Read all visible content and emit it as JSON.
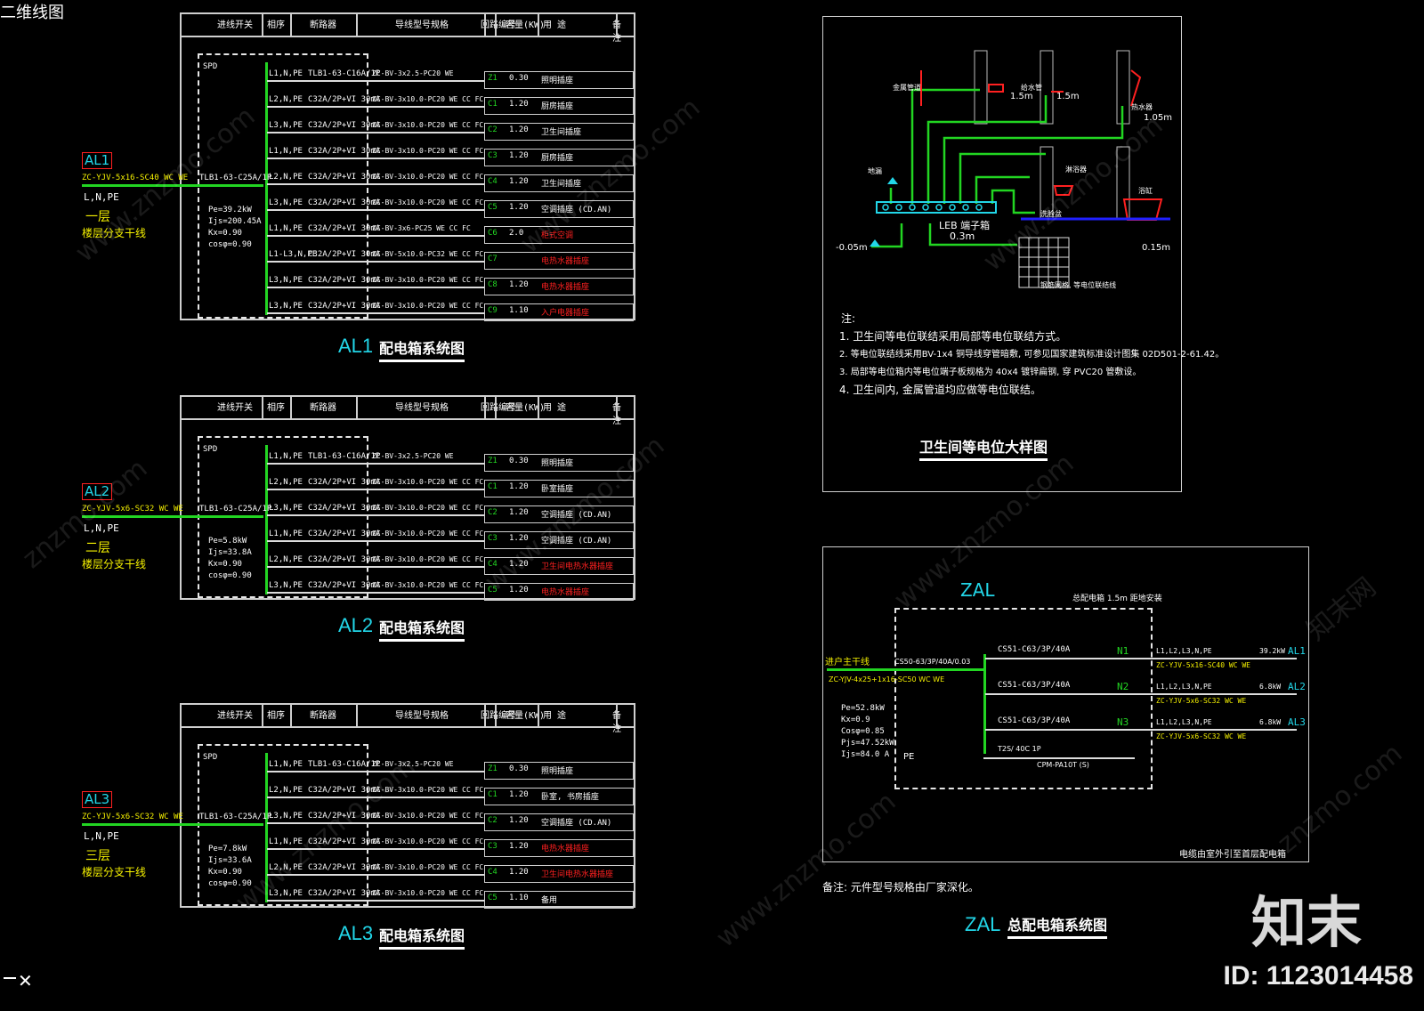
{
  "page_title": "二维线图",
  "panels": [
    {
      "id": "AL1",
      "feeder_cable": "ZC-YJV-5x16-SC40 WC WE",
      "phase": "L,N,PE",
      "floor": "一层",
      "floor_desc": "楼层分支干线",
      "main_breaker": "TLB1-63-C25A/1P",
      "params": [
        "Pe=39.2kW",
        "Ijs=200.45A",
        "Kx=0.90",
        "cosφ=0.90"
      ],
      "spd": "SPD",
      "caption": "AL1",
      "caption_cn": "配电箱系统图",
      "rows": [
        {
          "phase": "L1,N,PE",
          "breaker": "TLB1-63-C16A/1P",
          "cable": "ZC-BV-3x2.5-PC20 WE",
          "num": "Z1",
          "kw": "0.30",
          "desc": "照明插座",
          "red": false
        },
        {
          "phase": "L2,N,PE",
          "breaker": "C32A/2P+VI 30mA",
          "cable": "ZC-BV-3x10.0-PC20 WE CC FC",
          "num": "C1",
          "kw": "1.20",
          "desc": "厨房插座",
          "red": false
        },
        {
          "phase": "L3,N,PE",
          "breaker": "C32A/2P+VI 30mA",
          "cable": "ZC-BV-3x10.0-PC20 WE CC FC",
          "num": "C2",
          "kw": "1.20",
          "desc": "卫生间插座",
          "red": false
        },
        {
          "phase": "L1,N,PE",
          "breaker": "C32A/2P+VI 30mA",
          "cable": "ZC-BV-3x10.0-PC20 WE CC FC",
          "num": "C3",
          "kw": "1.20",
          "desc": "厨房插座",
          "red": false
        },
        {
          "phase": "L2,N,PE",
          "breaker": "C32A/2P+VI 30mA",
          "cable": "ZC-BV-3x10.0-PC20 WE CC FC",
          "num": "C4",
          "kw": "1.20",
          "desc": "卫生间插座",
          "red": false
        },
        {
          "phase": "L3,N,PE",
          "breaker": "C32A/2P+VI 30mA",
          "cable": "ZC-BV-3x10.0-PC20 WE CC FC",
          "num": "C5",
          "kw": "1.20",
          "desc": "空调插座 (CD.AN)",
          "red": false
        },
        {
          "phase": "L1,N,PE",
          "breaker": "C32A/2P+VI 30mA",
          "cable": "ZC-BV-3x6-PC25 WE CC FC",
          "num": "C6",
          "kw": "2.0",
          "desc": "柜式空调",
          "red": true
        },
        {
          "phase": "L1-L3,N,PE",
          "breaker": "C32A/2P+VI 30mA",
          "cable": "ZC-BV-5x10.0-PC32 WE CC FC",
          "num": "C7",
          "kw": "",
          "desc": "电热水器插座",
          "red": true
        },
        {
          "phase": "L3,N,PE",
          "breaker": "C32A/2P+VI 30mA",
          "cable": "ZC-BV-3x10.0-PC20 WE CC FC",
          "num": "C8",
          "kw": "1.20",
          "desc": "电热水器插座",
          "red": true
        },
        {
          "phase": "L3,N,PE",
          "breaker": "C32A/2P+VI 30mA",
          "cable": "ZC-BV-3x10.0-PC20 WE CC FC",
          "num": "C9",
          "kw": "1.10",
          "desc": "入户电器插座",
          "red": true
        }
      ]
    },
    {
      "id": "AL2",
      "feeder_cable": "ZC-YJV-5x6-SC32 WC WE",
      "phase": "L,N,PE",
      "floor": "二层",
      "floor_desc": "楼层分支干线",
      "main_breaker": "TLB1-63-C25A/1P",
      "params": [
        "Pe=5.8kW",
        "Ijs=33.8A",
        "Kx=0.90",
        "cosφ=0.90"
      ],
      "spd": "SPD",
      "caption": "AL2",
      "caption_cn": "配电箱系统图",
      "rows": [
        {
          "phase": "L1,N,PE",
          "breaker": "TLB1-63-C16A/1P",
          "cable": "ZC-BV-3x2.5-PC20 WE",
          "num": "Z1",
          "kw": "0.30",
          "desc": "照明插座",
          "red": false
        },
        {
          "phase": "L2,N,PE",
          "breaker": "C32A/2P+VI 30mA",
          "cable": "ZC-BV-3x10.0-PC20 WE CC FC",
          "num": "C1",
          "kw": "1.20",
          "desc": "卧室插座",
          "red": false
        },
        {
          "phase": "L3,N,PE",
          "breaker": "C32A/2P+VI 30mA",
          "cable": "ZC-BV-3x10.0-PC20 WE CC FC",
          "num": "C2",
          "kw": "1.20",
          "desc": "空调插座 (CD.AN)",
          "red": false
        },
        {
          "phase": "L1,N,PE",
          "breaker": "C32A/2P+VI 30mA",
          "cable": "ZC-BV-3x10.0-PC20 WE CC FC",
          "num": "C3",
          "kw": "1.20",
          "desc": "空调插座 (CD.AN)",
          "red": false
        },
        {
          "phase": "L2,N,PE",
          "breaker": "C32A/2P+VI 30mA",
          "cable": "ZC-BV-3x10.0-PC20 WE CC FC",
          "num": "C4",
          "kw": "1.20",
          "desc": "卫生间电热水器插座",
          "red": true
        },
        {
          "phase": "L3,N,PE",
          "breaker": "C32A/2P+VI 30mA",
          "cable": "ZC-BV-3x10.0-PC20 WE CC FC",
          "num": "C5",
          "kw": "1.20",
          "desc": "电热水器插座",
          "red": true
        }
      ]
    },
    {
      "id": "AL3",
      "feeder_cable": "ZC-YJV-5x6-SC32 WC WE",
      "phase": "L,N,PE",
      "floor": "三层",
      "floor_desc": "楼层分支干线",
      "main_breaker": "TLB1-63-C25A/1P",
      "params": [
        "Pe=7.8kW",
        "Ijs=33.6A",
        "Kx=0.90",
        "cosφ=0.90"
      ],
      "spd": "SPD",
      "caption": "AL3",
      "caption_cn": "配电箱系统图",
      "rows": [
        {
          "phase": "L1,N,PE",
          "breaker": "TLB1-63-C16A/1P",
          "cable": "ZC-BV-3x2.5-PC20 WE",
          "num": "Z1",
          "kw": "0.30",
          "desc": "照明插座",
          "red": false
        },
        {
          "phase": "L2,N,PE",
          "breaker": "C32A/2P+VI 30mA",
          "cable": "ZC-BV-3x10.0-PC20 WE CC FC",
          "num": "C1",
          "kw": "1.20",
          "desc": "卧室, 书房插座",
          "red": false
        },
        {
          "phase": "L3,N,PE",
          "breaker": "C32A/2P+VI 30mA",
          "cable": "ZC-BV-3x10.0-PC20 WE CC FC",
          "num": "C2",
          "kw": "1.20",
          "desc": "空调插座 (CD.AN)",
          "red": false
        },
        {
          "phase": "L1,N,PE",
          "breaker": "C32A/2P+VI 30mA",
          "cable": "ZC-BV-3x10.0-PC20 WE CC FC",
          "num": "C3",
          "kw": "1.20",
          "desc": "电热水器插座",
          "red": true
        },
        {
          "phase": "L2,N,PE",
          "breaker": "C32A/2P+VI 30mA",
          "cable": "ZC-BV-3x10.0-PC20 WE CC FC",
          "num": "C4",
          "kw": "1.20",
          "desc": "卫生间电热水器插座",
          "red": true
        },
        {
          "phase": "L3,N,PE",
          "breaker": "C32A/2P+VI 30mA",
          "cable": "ZC-BV-3x10.0-PC20 WE CC FC",
          "num": "C5",
          "kw": "1.10",
          "desc": "备用",
          "red": false
        }
      ]
    }
  ],
  "table_header": [
    "进线开关",
    "相序",
    "断路器",
    "导线型号规格",
    "回路编号",
    "容量(KW)",
    "用 途",
    "备 注"
  ],
  "bathroom": {
    "title": "卫生间等电位大样图",
    "leb_label": "LEB 端子箱",
    "leb_height": "0.3m",
    "heights": [
      "1.5m",
      "1.5m",
      "1.05m",
      "0.15m",
      "-0.05m"
    ],
    "label_items": [
      "金属管道",
      "给水管",
      "热水器",
      "淋浴器",
      "洗脸盆",
      "浴缸",
      "地漏"
    ],
    "grid_label": "钢筋网格, 等电位联结线",
    "notes_title": "注:",
    "notes": [
      "1. 卫生间等电位联结采用局部等电位联结方式。",
      "2. 等电位联结线采用BV-1x4 铜导线穿管暗敷, 可参见国家建筑标准设计图集 02D501-2-61.42。",
      "3. 局部等电位箱内等电位端子板规格为 40x4 镀锌扁钢, 穿 PVC20 管敷设。",
      "4. 卫生间内, 金属管道均应做等电位联结。"
    ]
  },
  "zal": {
    "title": "ZAL",
    "top_note": "总配电箱 1.5m 距地安装",
    "incoming": "进户主干线",
    "incoming_cable": "ZC-YJV-4x25+1x16-SC50 WC WE",
    "main_breaker": "CS50-63/3P/40A/0.03",
    "params": [
      "Pe=52.8kW",
      "Kx=0.9",
      "Cosφ=0.85",
      "Pjs=47.52kW",
      "Ijs=84.0 A"
    ],
    "pe_label": "PE",
    "spd": "T2S/ 40C 1P",
    "meter": "CPM-PA10T (S)",
    "circuits": [
      {
        "n": "N1",
        "breaker": "CS51-C63/3P/40A",
        "phase": "L1,L2,L3,N,PE",
        "cable": "ZC-YJV-5x16-SC40 WC WE",
        "kw": "39.2kW",
        "target": "AL1"
      },
      {
        "n": "N2",
        "breaker": "CS51-C63/3P/40A",
        "phase": "L1,L2,L3,N,PE",
        "cable": "ZC-YJV-5x6-SC32 WC WE",
        "kw": "6.8kW",
        "target": "AL2"
      },
      {
        "n": "N3",
        "breaker": "CS51-C63/3P/40A",
        "phase": "L1,L2,L3,N,PE",
        "cable": "ZC-YJV-5x6-SC32 WC WE",
        "kw": "6.8kW",
        "target": "AL3"
      }
    ],
    "bottom_note": "电缆由室外引至首层配电箱",
    "remark": "备注: 元件型号规格由厂家深化。",
    "caption": "ZAL",
    "caption_cn": "总配电箱系统图"
  },
  "watermarks": [
    "www.znzmo.com",
    "知末网",
    "znzmo.com"
  ],
  "logo": "知末",
  "id_text": "ID: 1123014458",
  "colors": {
    "bus": "#22d522",
    "label": "#22d6e8",
    "highlight": "#f4f000",
    "alarm": "#ff2020"
  }
}
